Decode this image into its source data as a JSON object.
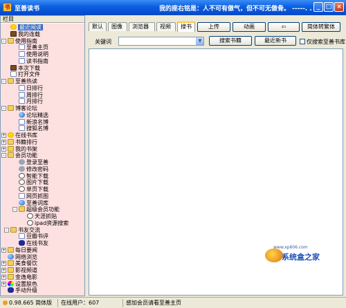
{
  "window": {
    "title": "至善读书",
    "marquee": "我的座右铭是：人不可有傲气，但不可无傲骨。 -----. . .",
    "controls": {
      "minimize": "_",
      "maximize": "□",
      "close": "×"
    }
  },
  "left_panel": {
    "header": "栏目",
    "tree": [
      {
        "label": "最近阅读",
        "icon": "star-icon",
        "expander": "",
        "selected": true
      },
      {
        "label": "我的连载",
        "icon": "book-icon",
        "expander": ""
      },
      {
        "label": "使用指南",
        "icon": "folder-icon",
        "expander": "-"
      },
      {
        "label": "至善主页",
        "icon": "doc-icon",
        "expander": ""
      },
      {
        "label": "使用说明",
        "icon": "doc-icon",
        "expander": ""
      },
      {
        "label": "读书指南",
        "icon": "doc-icon",
        "expander": ""
      },
      {
        "label": "本次下载",
        "icon": "book-icon",
        "expander": ""
      },
      {
        "label": "打开文件",
        "icon": "doc-icon",
        "expander": ""
      },
      {
        "label": "至善热读",
        "icon": "folder-icon",
        "expander": "-"
      },
      {
        "label": "日排行",
        "icon": "doc-icon",
        "expander": ""
      },
      {
        "label": "周排行",
        "icon": "doc-icon",
        "expander": ""
      },
      {
        "label": "月排行",
        "icon": "doc-icon",
        "expander": ""
      },
      {
        "label": "博客论坛",
        "icon": "folder-icon",
        "expander": "-"
      },
      {
        "label": "论坛精选",
        "icon": "globe-icon",
        "expander": ""
      },
      {
        "label": "新浪名博",
        "icon": "doc-icon",
        "expander": ""
      },
      {
        "label": "搜狐名博",
        "icon": "doc-icon",
        "expander": ""
      },
      {
        "label": "在线书库",
        "icon": "star-icon",
        "expander": "+"
      },
      {
        "label": "书籍排行",
        "icon": "folder-icon",
        "expander": "+"
      },
      {
        "label": "我的书架",
        "icon": "folder-icon",
        "expander": "+"
      },
      {
        "label": "会员功能",
        "icon": "folder-icon",
        "expander": "-"
      },
      {
        "label": "登录至善",
        "icon": "gear-icon",
        "expander": ""
      },
      {
        "label": "修改密码",
        "icon": "gear-icon",
        "expander": ""
      },
      {
        "label": "智能下载",
        "icon": "search-icon",
        "expander": ""
      },
      {
        "label": "图片下载",
        "icon": "search-icon",
        "expander": ""
      },
      {
        "label": "单页下载",
        "icon": "search-icon",
        "expander": ""
      },
      {
        "label": "网页抓图",
        "icon": "doc-icon",
        "expander": ""
      },
      {
        "label": "至善词库",
        "icon": "globe-icon",
        "expander": ""
      },
      {
        "label": "超级会员功能",
        "icon": "folder-icon",
        "expander": "-"
      },
      {
        "label": "天涯抓贴",
        "icon": "search-icon",
        "expander": ""
      },
      {
        "label": "ipad资源搜索",
        "icon": "search-icon",
        "expander": ""
      },
      {
        "label": "书友交流",
        "icon": "folder-icon",
        "expander": "-"
      },
      {
        "label": "豆瓣书评",
        "icon": "doc-icon",
        "expander": ""
      },
      {
        "label": "在线书友",
        "icon": "fly-icon",
        "expander": ""
      },
      {
        "label": "每日要闻",
        "icon": "folder-icon",
        "expander": "+"
      },
      {
        "label": "网络浏览",
        "icon": "globe-icon",
        "expander": ""
      },
      {
        "label": "美食餐饮",
        "icon": "folder-icon",
        "expander": "+"
      },
      {
        "label": "影视频道",
        "icon": "folder-icon",
        "expander": "+"
      },
      {
        "label": "金逸电影",
        "icon": "folder-icon",
        "expander": "+"
      },
      {
        "label": "设置肤色",
        "icon": "color-icon",
        "expander": "+"
      },
      {
        "label": "手动升级",
        "icon": "fly-icon",
        "expander": ""
      }
    ]
  },
  "tabs": [
    {
      "label": "默认",
      "active": false
    },
    {
      "label": "图像",
      "active": false
    },
    {
      "label": "浏览器",
      "active": false
    },
    {
      "label": "视频",
      "active": false
    },
    {
      "label": "搜书",
      "active": true
    }
  ],
  "toolbar": {
    "upload": "上传",
    "animation": "动画",
    "back": "⇦",
    "convert": "简体转繁体",
    "keyword_label": "关键词",
    "keyword_value": "",
    "search_books": "搜索书籍",
    "latest_books": "最近新书",
    "only_zhishan": "仅搜索至善书库"
  },
  "watermark": {
    "url": "www.xp606.com",
    "text": "系统盒之家"
  },
  "statusbar": {
    "version": "0.98.665 简体版",
    "online_users": "在线用户：607",
    "message": "感加会员请看至善主页"
  },
  "colors": {
    "tree_bg": "#fde0e0",
    "titlebar": "#0a5fe0",
    "selection": "#316ac5"
  }
}
